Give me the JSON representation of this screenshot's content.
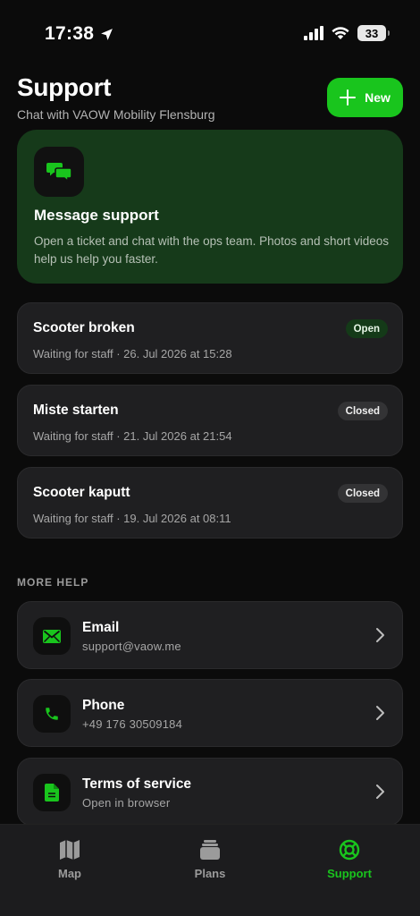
{
  "status_bar": {
    "time": "17:38",
    "battery": "33"
  },
  "header": {
    "title": "Support",
    "subtitle": "Chat with VAOW Mobility Flensburg",
    "new_label": "New"
  },
  "hero": {
    "title": "Message support",
    "description": "Open a ticket and chat with the ops team. Photos and short videos help us help you faster."
  },
  "tickets": [
    {
      "title": "Scooter broken",
      "meta": "Waiting for staff · 26. Jul 2026 at 15:28",
      "status": "Open"
    },
    {
      "title": "Miste starten",
      "meta": "Waiting for staff · 21. Jul 2026 at 21:54",
      "status": "Closed"
    },
    {
      "title": "Scooter kaputt",
      "meta": "Waiting for staff · 19. Jul 2026 at 08:11",
      "status": "Closed"
    }
  ],
  "more_help": {
    "label": "MORE HELP",
    "items": [
      {
        "title": "Email",
        "subtitle": "support@vaow.me",
        "icon": "mail-icon"
      },
      {
        "title": "Phone",
        "subtitle": "+49 176 30509184",
        "icon": "phone-icon"
      },
      {
        "title": "Terms of service",
        "subtitle": "Open in browser",
        "icon": "document-icon"
      }
    ]
  },
  "tabbar": {
    "tabs": [
      {
        "label": "Map",
        "icon": "map-icon",
        "active": false
      },
      {
        "label": "Plans",
        "icon": "stack-icon",
        "active": false
      },
      {
        "label": "Support",
        "icon": "lifebuoy-icon",
        "active": true
      }
    ]
  },
  "colors": {
    "accent": "#19c51d",
    "hero_bg": "#163a1a",
    "card_bg": "#1f1f21",
    "background": "#0b0b0b"
  }
}
